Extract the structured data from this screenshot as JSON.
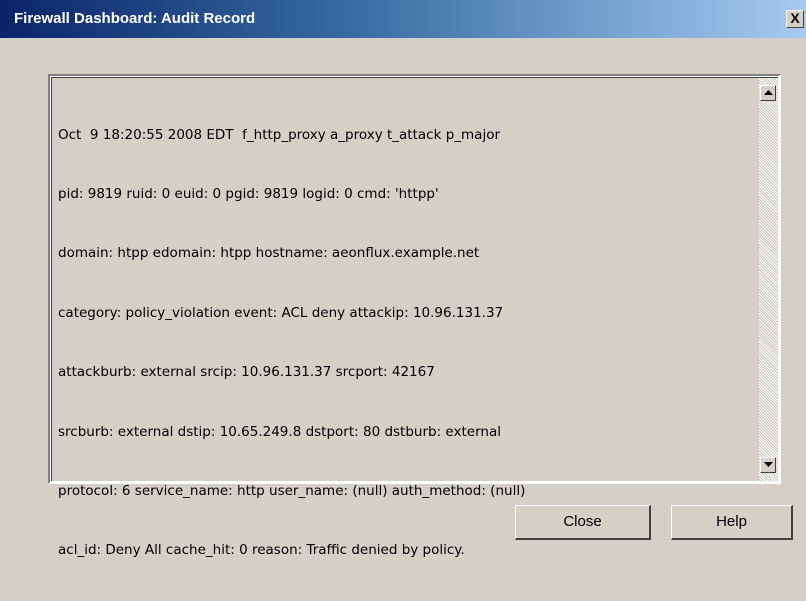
{
  "window": {
    "title": "Firewall Dashboard: Audit Record",
    "close_glyph": "X"
  },
  "audit_record": {
    "lines": [
      "Oct  9 18:20:55 2008 EDT  f_http_proxy a_proxy t_attack p_major",
      "pid: 9819 ruid: 0 euid: 0 pgid: 9819 logid: 0 cmd: 'httpp'",
      "domain: htpp edomain: htpp hostname: aeonflux.example.net",
      "category: policy_violation event: ACL deny attackip: 10.96.131.37",
      "attackburb: external srcip: 10.96.131.37 srcport: 42167",
      "srcburb: external dstip: 10.65.249.8 dstport: 80 dstburb: external",
      "protocol: 6 service_name: http user_name: (null) auth_method: (null)",
      "acl_id: Deny All cache_hit: 0 reason: Traffic denied by policy."
    ]
  },
  "scrollbar": {
    "up_icon": "arrow-up-icon",
    "down_icon": "arrow-down-icon"
  },
  "buttons": {
    "close_label": "Close",
    "help_label": "Help"
  },
  "colors": {
    "titlebar_start": "#0a246a",
    "titlebar_end": "#a6caf0",
    "dialog_face": "#d4d0c8",
    "title_text": "#ffffff"
  }
}
